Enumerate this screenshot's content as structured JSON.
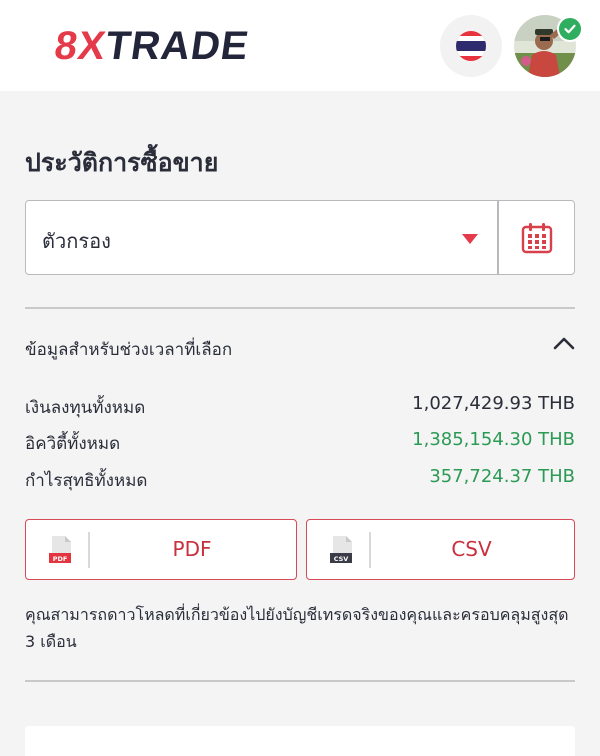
{
  "header": {
    "logo_part1": "8X",
    "logo_part2": "TRADE"
  },
  "page": {
    "title": "ประวัติการซื้อขาย"
  },
  "filter": {
    "label": "ตัวกรอง"
  },
  "summary": {
    "title": "ข้อมูลสำหรับช่วงเวลาที่เลือก",
    "rows": [
      {
        "label": "เงินลงทุนทั้งหมด",
        "value": "1,027,429.93 THB"
      },
      {
        "label": "อิควิตี้ทั้งหมด",
        "value": "1,385,154.30 THB"
      },
      {
        "label": "กำไรสุทธิทั้งหมด",
        "value": "357,724.37 THB"
      }
    ]
  },
  "downloads": {
    "pdf_label": "PDF",
    "pdf_icon_text": "PDF",
    "csv_label": "CSV",
    "csv_icon_text": "CSV"
  },
  "note": "คุณสามารถดาวโหลดที่เกี่ยวข้องไปยังบัญชีเทรดจริงของคุณและครอบคลุมสูงสุด 3 เดือน",
  "colors": {
    "brand_red": "#e43a49",
    "profit_green": "#2a9a55",
    "text_dark": "#2b2e3a",
    "verified_green": "#2fae60"
  }
}
